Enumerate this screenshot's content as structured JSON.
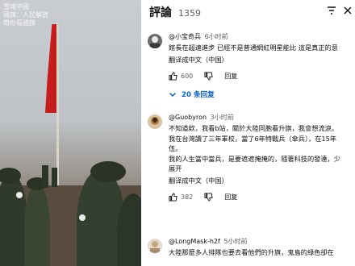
{
  "watermark": [
    "雪域中國",
    "國旗：人民解放",
    "帶你看國旗"
  ],
  "header": {
    "title": "評論",
    "count": "1359"
  },
  "comments": [
    {
      "author": "@小宝奇兵",
      "time": "6小时前",
      "lines": [
        "館長在超速進步 已經不是普通網紅明星能比 這是真正的意"
      ],
      "translate": "翻译成中文（中国）",
      "likes": "600",
      "reply": "回复",
      "replies": "20 条回复"
    },
    {
      "author": "@Guobyron",
      "time": "3小时前",
      "lines": [
        "不知道欸，我看b站，關於大陸同胞看升旗，我會想流淚。",
        "我在台灣讀了三年軍校，當了6年特戰兵（傘兵），在15年",
        "伍。",
        "我的人生當中當兵，是要遮遮掩掩的，隨著科技的發達，少"
      ],
      "more": "展开",
      "translate": "翻译成中文（中国）",
      "likes": "382",
      "reply": "回复"
    },
    {
      "author": "@LongMask-h2f",
      "time": "5小时前",
      "lines": [
        "大陸那麼多人排隊也要去看他們的升旗，鬼島的綠色卻在"
      ]
    }
  ],
  "colors": {
    "flag": "#c51d1d",
    "link": "#065fd4"
  }
}
